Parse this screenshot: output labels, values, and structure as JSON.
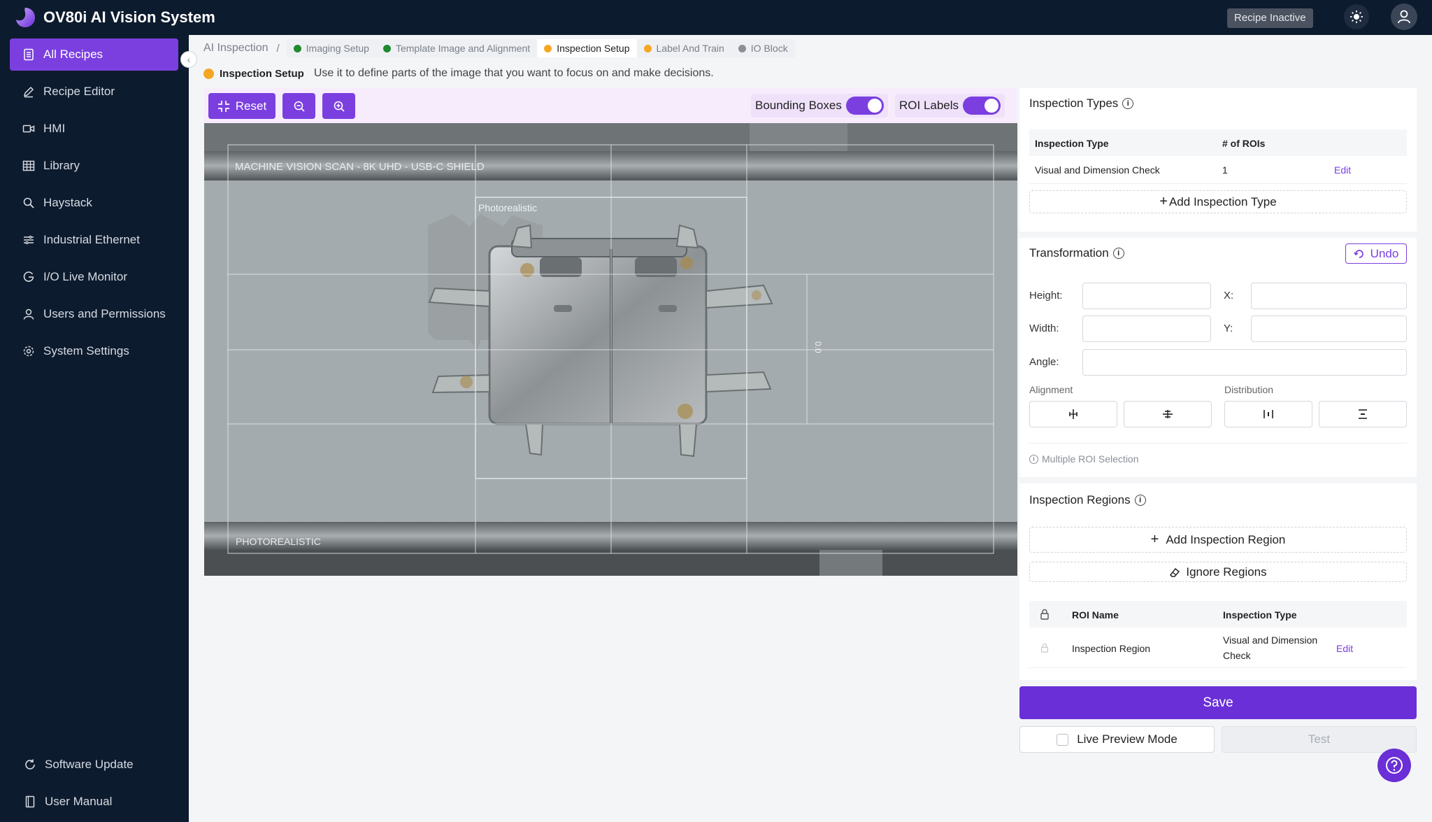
{
  "app": {
    "title": "OV80i AI Vision System",
    "recipe_status": "Recipe Inactive"
  },
  "colors": {
    "accent": "#7b3fe0",
    "sidebar_bg": "#0d1b2e",
    "done": "#1f8a2e",
    "active": "#f5a623",
    "pending": "#8a8f98"
  },
  "sidebar": {
    "items": [
      {
        "label": "All Recipes",
        "icon": "document-list-icon"
      },
      {
        "label": "Recipe Editor",
        "icon": "pencil-icon"
      },
      {
        "label": "HMI",
        "icon": "video-icon"
      },
      {
        "label": "Library",
        "icon": "grid-icon"
      },
      {
        "label": "Haystack",
        "icon": "search-icon"
      },
      {
        "label": "Industrial Ethernet",
        "icon": "network-icon"
      },
      {
        "label": "I/O Live Monitor",
        "icon": "monitor-icon"
      },
      {
        "label": "Users and Permissions",
        "icon": "user-icon"
      },
      {
        "label": "System Settings",
        "icon": "gear-icon"
      }
    ],
    "bottom_items": [
      {
        "label": "Software Update",
        "icon": "refresh-icon"
      },
      {
        "label": "User Manual",
        "icon": "book-icon"
      }
    ]
  },
  "breadcrumb": {
    "root": "AI Inspection",
    "separator": "/",
    "tabs": [
      {
        "label": "Imaging Setup",
        "status": "done"
      },
      {
        "label": "Template Image and Alignment",
        "status": "done"
      },
      {
        "label": "Inspection Setup",
        "status": "active"
      },
      {
        "label": "Label And Train",
        "status": "active"
      },
      {
        "label": "IO Block",
        "status": "pending"
      }
    ]
  },
  "step": {
    "name": "Inspection Setup",
    "description": "Use it to define parts of the image that you want to focus on and make decisions."
  },
  "toolbar": {
    "reset_label": "Reset",
    "bounding_boxes_label": "Bounding Boxes",
    "bounding_boxes_on": true,
    "roi_labels_label": "ROI Labels",
    "roi_labels_on": true
  },
  "canvas": {
    "scan_label": "MACHINE VISION SCAN - 8K UHD - USB-C SHIELD",
    "roi_label": "Photorealistic",
    "footer_label": "PHOTOREALISTIC",
    "side_label": "0.0"
  },
  "inspection_types": {
    "title": "Inspection Types",
    "columns": [
      "Inspection Type",
      "# of ROIs"
    ],
    "rows": [
      {
        "type": "Visual and Dimension Check",
        "rois": "1",
        "action": "Edit"
      }
    ],
    "add_label": "Add Inspection Type"
  },
  "transformation": {
    "title": "Transformation",
    "undo_label": "Undo",
    "height_label": "Height:",
    "width_label": "Width:",
    "x_label": "X:",
    "y_label": "Y:",
    "angle_label": "Angle:",
    "height": "",
    "width": "",
    "x": "",
    "y": "",
    "angle": "",
    "alignment_label": "Alignment",
    "distribution_label": "Distribution",
    "note": "Multiple ROI Selection"
  },
  "inspection_regions": {
    "title": "Inspection Regions",
    "add_label": "Add Inspection Region",
    "ignore_label": "Ignore Regions",
    "columns": [
      "ROI Name",
      "Inspection Type"
    ],
    "rows": [
      {
        "name": "Inspection Region",
        "type_line1": "Visual and Dimension",
        "type_line2": "Check",
        "action": "Edit"
      }
    ]
  },
  "actions": {
    "save_label": "Save",
    "live_preview_label": "Live Preview Mode",
    "test_label": "Test"
  }
}
